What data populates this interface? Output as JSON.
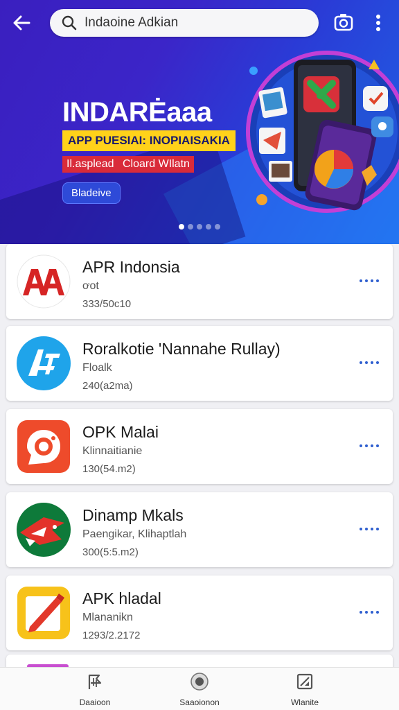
{
  "search": {
    "value": "Indaoine Adkian"
  },
  "banner": {
    "title": "INDARĖaaa",
    "subtitle": "APP PUESIAI: INOPIAISAKIA",
    "tags": [
      "Il.asplead",
      "Cloard WIlatn"
    ],
    "cta": "Bladeive",
    "carousel_pages": 5,
    "carousel_active": 1
  },
  "apps": [
    {
      "name": "APR Indonsia",
      "developer": "ơot",
      "meta": "333/50c10",
      "icon": "aa-red-logo-icon"
    },
    {
      "name": "Roralkotie 'Nannahe Rullay)",
      "developer": "Floalk",
      "meta": "240(a2ma)",
      "icon": "blue-a-logo-icon"
    },
    {
      "name": "OPK Malai",
      "developer": "Klinnaitianie",
      "meta": "130(54.m2)",
      "icon": "red-camera-logo-icon"
    },
    {
      "name": "Dinamp Mkals",
      "developer": "Paengikar, Klihaptlah",
      "meta": "300(5:5.m2)",
      "icon": "green-bird-logo-icon"
    },
    {
      "name": "APK hladal",
      "developer": "Mlananikn",
      "meta": "1293/2.2172",
      "icon": "yellow-pencil-logo-icon"
    }
  ],
  "bottom_nav": [
    {
      "label": "Daaioon",
      "icon": "flag-icon"
    },
    {
      "label": "Saaoionon",
      "icon": "record-icon"
    },
    {
      "label": "Wlanite",
      "icon": "image-edit-icon"
    }
  ],
  "colors": {
    "accent": "#2f5fcf",
    "banner_start": "#3a1fbf",
    "banner_end": "#1f64e6",
    "tag_red": "#d92b3a",
    "highlight_yellow": "#ffd21a"
  }
}
